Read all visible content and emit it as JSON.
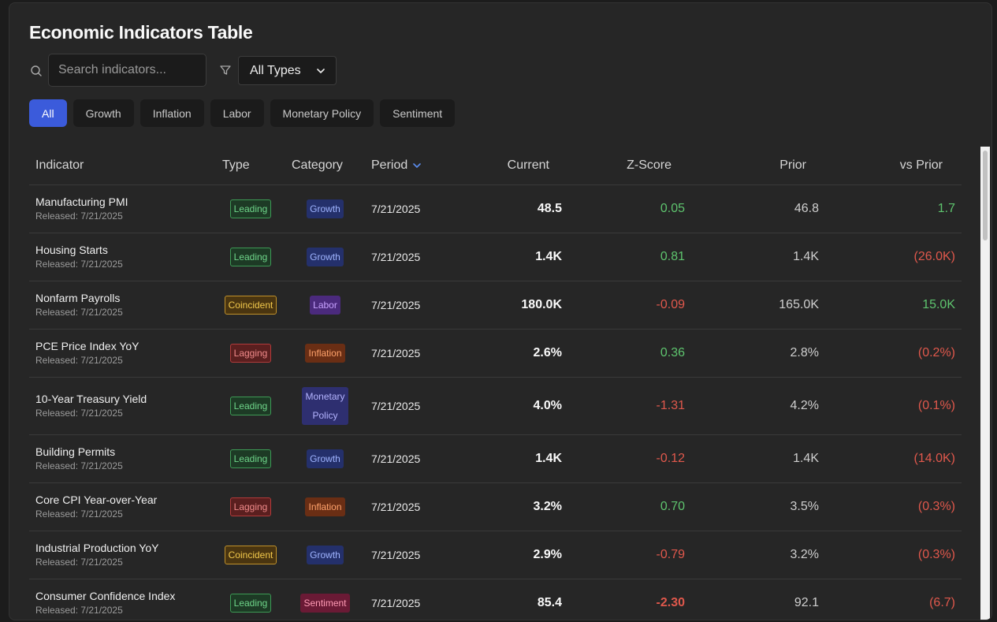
{
  "title": "Economic Indicators Table",
  "search": {
    "placeholder": "Search indicators..."
  },
  "type_filter": {
    "selected": "All Types"
  },
  "category_chips": [
    "All",
    "Growth",
    "Inflation",
    "Labor",
    "Monetary Policy",
    "Sentiment"
  ],
  "active_chip": "All",
  "columns": {
    "indicator": "Indicator",
    "type": "Type",
    "category": "Category",
    "period": "Period",
    "current": "Current",
    "zscore": "Z-Score",
    "prior": "Prior",
    "vs_prior": "vs Prior"
  },
  "sort": {
    "column": "Period",
    "direction": "desc"
  },
  "rows": [
    {
      "name": "Manufacturing PMI",
      "released": "Released: 7/21/2025",
      "type": "Leading",
      "category": "Growth",
      "period": "7/21/2025",
      "current": "48.5",
      "zscore": "0.05",
      "prior": "46.8",
      "vs_prior": "1.7"
    },
    {
      "name": "Housing Starts",
      "released": "Released: 7/21/2025",
      "type": "Leading",
      "category": "Growth",
      "period": "7/21/2025",
      "current": "1.4K",
      "zscore": "0.81",
      "prior": "1.4K",
      "vs_prior": "(26.0K)"
    },
    {
      "name": "Nonfarm Payrolls",
      "released": "Released: 7/21/2025",
      "type": "Coincident",
      "category": "Labor",
      "period": "7/21/2025",
      "current": "180.0K",
      "zscore": "-0.09",
      "prior": "165.0K",
      "vs_prior": "15.0K"
    },
    {
      "name": "PCE Price Index YoY",
      "released": "Released: 7/21/2025",
      "type": "Lagging",
      "category": "Inflation",
      "period": "7/21/2025",
      "current": "2.6%",
      "zscore": "0.36",
      "prior": "2.8%",
      "vs_prior": "(0.2%)"
    },
    {
      "name": "10-Year Treasury Yield",
      "released": "Released: 7/21/2025",
      "type": "Leading",
      "category": "Monetary Policy",
      "category_lines": [
        "Monetary",
        "Policy"
      ],
      "period": "7/21/2025",
      "current": "4.0%",
      "zscore": "-1.31",
      "prior": "4.2%",
      "vs_prior": "(0.1%)"
    },
    {
      "name": "Building Permits",
      "released": "Released: 7/21/2025",
      "type": "Leading",
      "category": "Growth",
      "period": "7/21/2025",
      "current": "1.4K",
      "zscore": "-0.12",
      "prior": "1.4K",
      "vs_prior": "(14.0K)"
    },
    {
      "name": "Core CPI Year-over-Year",
      "released": "Released: 7/21/2025",
      "type": "Lagging",
      "category": "Inflation",
      "period": "7/21/2025",
      "current": "3.2%",
      "zscore": "0.70",
      "prior": "3.5%",
      "vs_prior": "(0.3%)"
    },
    {
      "name": "Industrial Production YoY",
      "released": "Released: 7/21/2025",
      "type": "Coincident",
      "category": "Growth",
      "period": "7/21/2025",
      "current": "2.9%",
      "zscore": "-0.79",
      "prior": "3.2%",
      "vs_prior": "(0.3%)"
    },
    {
      "name": "Consumer Confidence Index",
      "released": "Released: 7/21/2025",
      "type": "Leading",
      "category": "Sentiment",
      "period": "7/21/2025",
      "current": "85.4",
      "zscore": "-2.30",
      "prior": "92.1",
      "vs_prior": "(6.7)"
    }
  ],
  "colors": {
    "accent": "#3b5bdb",
    "positive": "#5ec46e",
    "negative": "#e0584c",
    "panel": "#262626"
  },
  "icons": {
    "search": "search-icon",
    "filter": "filter-icon",
    "sort": "chevron-down-icon",
    "select": "chevron-down-icon"
  }
}
